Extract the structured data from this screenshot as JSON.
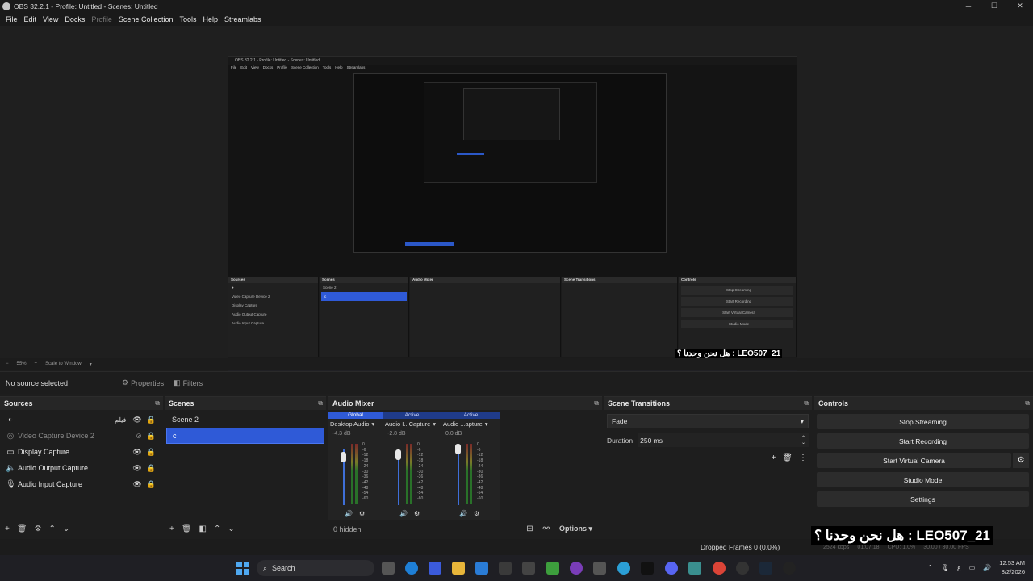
{
  "window": {
    "title": "OBS 32.2.1 - Profile: Untitled - Scenes: Untitled",
    "controls": [
      "─",
      "☐",
      "✕"
    ]
  },
  "menu": [
    "File",
    "Edit",
    "View",
    "Docks",
    "Profile",
    "Scene Collection",
    "Tools",
    "Help",
    "Streamlabs"
  ],
  "preview": {
    "nested_title": "OBS 32.2.1 - Profile: Untitled - Scenes: Untitled",
    "nested_menu": [
      "File",
      "Edit",
      "View",
      "Docks",
      "Profile",
      "Scene Collection",
      "Tools",
      "Help",
      "Streamlabs"
    ],
    "nested_docks": [
      "Sources",
      "Scenes",
      "Audio Mixer",
      "Scene Transitions",
      "Controls"
    ],
    "nested_sources": [
      "Video Capture Device 2",
      "Display Capture",
      "Audio Output Capture",
      "Audio Input Capture"
    ],
    "nested_scenes": [
      "Scene 2",
      "c"
    ],
    "nested_controls": [
      "Stop Streaming",
      "Start Recording",
      "Start Virtual Camera",
      "Studio Mode",
      "Settings"
    ],
    "nested_overlay": "هل نحن وحدنا ؟ : LEO507_21",
    "nested_dropped": "Dropped Frames 0 (0.0%)"
  },
  "zoombar": {
    "zoom": "55%",
    "mode": "Scale to Window"
  },
  "source_bar": {
    "no_source": "No source selected",
    "properties": "Properties",
    "filters": "Filters"
  },
  "sources": {
    "title": "Sources",
    "items": [
      {
        "label": "",
        "arabic": "فيلم",
        "icon": "circle-icon",
        "dim": false
      },
      {
        "label": "Video Capture Device 2",
        "icon": "camera-icon",
        "dim": true
      },
      {
        "label": "Display Capture",
        "icon": "monitor-icon",
        "dim": false
      },
      {
        "label": "Audio Output Capture",
        "icon": "speaker-icon",
        "dim": false
      },
      {
        "label": "Audio Input Capture",
        "icon": "microphone-icon",
        "dim": false
      }
    ]
  },
  "scenes": {
    "title": "Scenes",
    "items": [
      {
        "label": "Scene 2",
        "selected": false
      },
      {
        "label": "c",
        "selected": true
      }
    ]
  },
  "mixer": {
    "title": "Audio Mixer",
    "channels": [
      {
        "tag": "Global",
        "name": "Desktop Audio",
        "db": "-4.3 dB"
      },
      {
        "tag": "Active",
        "name": "Audio I...Capture",
        "db": "-2.8 dB"
      },
      {
        "tag": "Active",
        "name": "Audio ...apture",
        "db": "0.0 dB"
      }
    ],
    "ticks": [
      "0",
      "-6",
      "-12",
      "-18",
      "-24",
      "-30",
      "-36",
      "-42",
      "-48",
      "-54",
      "-60"
    ],
    "hidden": "0 hidden",
    "options": "Options"
  },
  "transitions": {
    "title": "Scene Transitions",
    "type": "Fade",
    "duration_label": "Duration",
    "duration": "250 ms"
  },
  "controls": {
    "title": "Controls",
    "buttons": [
      "Stop Streaming",
      "Start Recording",
      "Start Virtual Camera",
      "Studio Mode",
      "Settings"
    ]
  },
  "status": {
    "dropped": "Dropped Frames 0 (0.0%)",
    "bitrate": "2524 kbps",
    "time": "01:07:18",
    "cpu": "CPU: 1.0%",
    "fps": "30.00 / 30.00 FPS"
  },
  "overlay_text": "هل نحن وحدنا ؟ : LEO507_21",
  "taskbar": {
    "search": "Search",
    "time": "12:53 AM",
    "date": "8/2/2026",
    "lang": "ع"
  },
  "colors": {
    "accent": "#2f5ad7",
    "background": "#1e1e1e"
  }
}
